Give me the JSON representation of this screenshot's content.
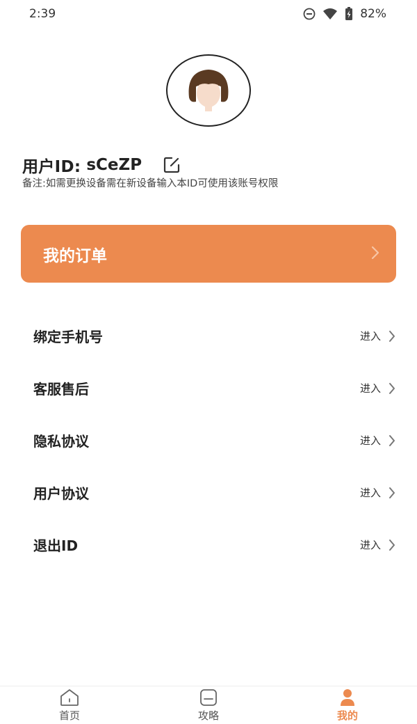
{
  "status_bar": {
    "time": "2:39",
    "battery_percent": "82%",
    "icons": [
      "do-not-disturb-icon",
      "wifi-icon",
      "battery-icon"
    ]
  },
  "profile": {
    "avatar_icon": "girl-avatar-icon",
    "user_id_label": "用户ID:",
    "user_id_value": "sCeZP",
    "remark": "备注:如需更换设备需在新设备输入本ID可使用该账号权限"
  },
  "order": {
    "title": "我的订单",
    "color": "#ec8a4f"
  },
  "menu": {
    "items": [
      {
        "label": "绑定手机号",
        "action": "进入"
      },
      {
        "label": "客服售后",
        "action": "进入"
      },
      {
        "label": "隐私协议",
        "action": "进入"
      },
      {
        "label": "用户协议",
        "action": "进入"
      },
      {
        "label": "退出ID",
        "action": "进入"
      }
    ]
  },
  "bottom_nav": {
    "tabs": [
      {
        "label": "首页",
        "icon": "home-icon",
        "active": false
      },
      {
        "label": "攻略",
        "icon": "guide-icon",
        "active": false
      },
      {
        "label": "我的",
        "icon": "user-icon",
        "active": true
      }
    ],
    "active_color": "#ec8a4f"
  }
}
